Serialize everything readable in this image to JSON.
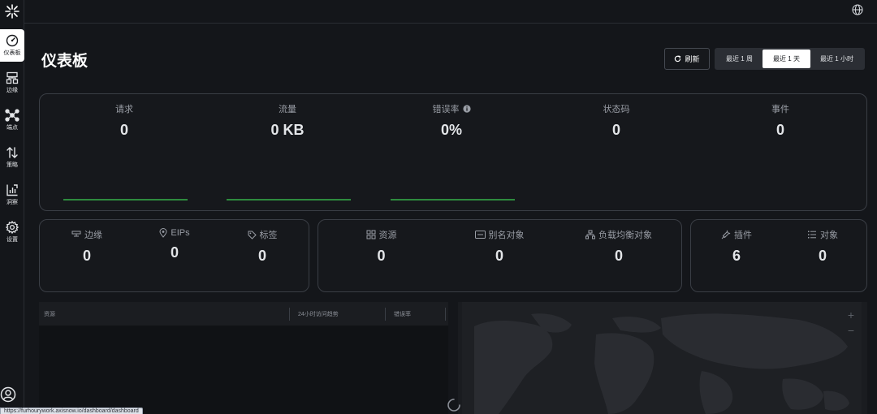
{
  "nav": {
    "items": [
      {
        "label": "仪表板",
        "icon": "dashboard-gauge-icon",
        "active": true
      },
      {
        "label": "边缘",
        "icon": "edge-sitemap-icon",
        "active": false
      },
      {
        "label": "端点",
        "icon": "endpoints-network-icon",
        "active": false
      },
      {
        "label": "策略",
        "icon": "policy-arrows-icon",
        "active": false
      },
      {
        "label": "洞察",
        "icon": "insights-chart-icon",
        "active": false
      },
      {
        "label": "设置",
        "icon": "settings-gear-icon",
        "active": false
      }
    ]
  },
  "page": {
    "title": "仪表板",
    "refresh_label": "刷新",
    "ranges": [
      "最近 1 周",
      "最近 1 天",
      "最近 1 小时"
    ],
    "selected_range": "最近 1 天"
  },
  "traffic": {
    "metrics": [
      {
        "label": "请求",
        "value": "0"
      },
      {
        "label": "流量",
        "value": "0 KB"
      },
      {
        "label": "错误率",
        "value": "0%"
      },
      {
        "label": "状态码",
        "value": "0"
      },
      {
        "label": "事件",
        "value": "0"
      }
    ]
  },
  "edge_card": {
    "metrics": [
      {
        "label": "边缘",
        "value": "0"
      },
      {
        "label": "EIPs",
        "value": "0"
      },
      {
        "label": "标签",
        "value": "0"
      }
    ]
  },
  "resource_card": {
    "metrics": [
      {
        "label": "资源",
        "value": "0"
      },
      {
        "label": "别名对象",
        "value": "0"
      },
      {
        "label": "负载均衡对象",
        "value": "0"
      }
    ]
  },
  "plugin_card": {
    "metrics": [
      {
        "label": "插件",
        "value": "6"
      },
      {
        "label": "对象",
        "value": "0"
      }
    ]
  },
  "table": {
    "columns": [
      "资源",
      "24小时访问趋势",
      "错误率"
    ]
  },
  "map": {
    "zoom_in": "+",
    "zoom_out": "−"
  },
  "status_bar": {
    "url": "https://furhourywork.axisnow.io/dashboard/dashboard"
  },
  "colors": {
    "background": "#14161a",
    "card_border": "#3a3e45",
    "sparkline": "#2e8b3e",
    "active_nav": "#ffffff"
  }
}
